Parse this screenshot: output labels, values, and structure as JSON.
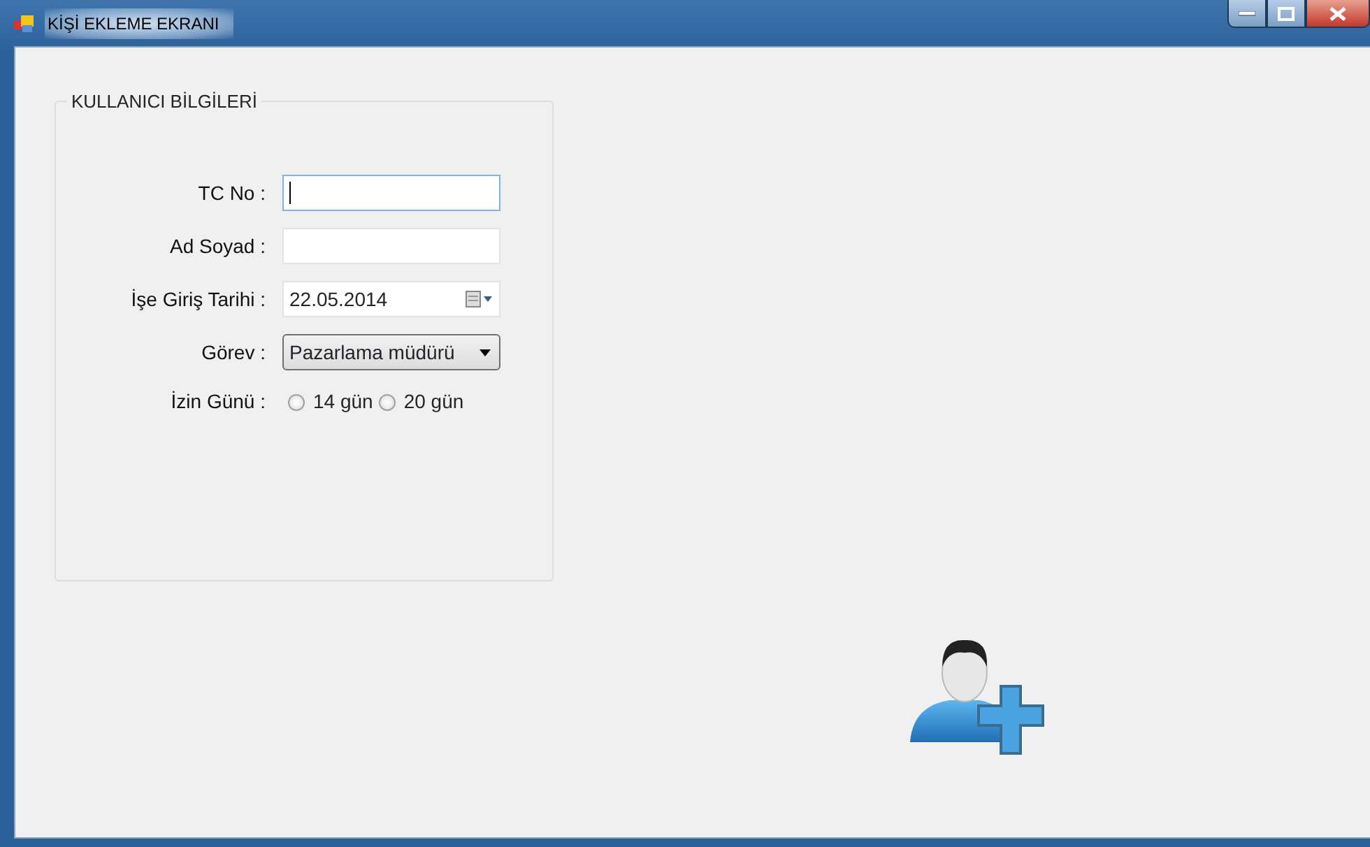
{
  "window": {
    "title": "KİŞİ EKLEME EKRANI"
  },
  "group": {
    "title": "KULLANICI BİLGİLERİ",
    "fields": [
      {
        "kind": "text",
        "label": "TC No :",
        "focused": true
      },
      {
        "kind": "text",
        "label": "Ad Soyad :",
        "focused": false
      },
      {
        "kind": "date",
        "label": "İşe Giriş Tarihi :",
        "value": "22.05.2014"
      },
      {
        "kind": "combo",
        "label": "Görev :",
        "value": "Pazarlama müdürü"
      },
      {
        "kind": "radio",
        "label": "İzin Günü :",
        "options": [
          {
            "label": "14 gün",
            "selected": false
          },
          {
            "label": "20 gün",
            "selected": false
          }
        ]
      }
    ]
  }
}
